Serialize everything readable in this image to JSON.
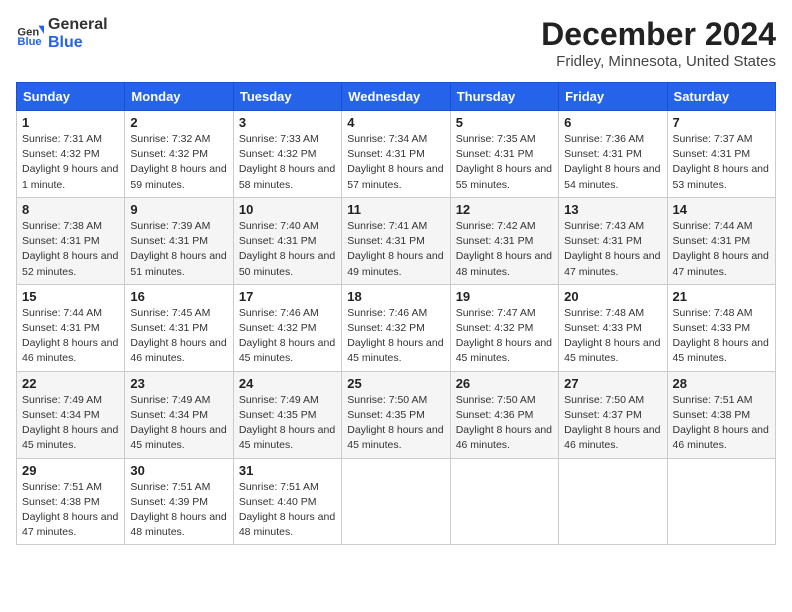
{
  "header": {
    "logo_line1": "General",
    "logo_line2": "Blue",
    "month_title": "December 2024",
    "location": "Fridley, Minnesota, United States"
  },
  "weekdays": [
    "Sunday",
    "Monday",
    "Tuesday",
    "Wednesday",
    "Thursday",
    "Friday",
    "Saturday"
  ],
  "weeks": [
    [
      {
        "day": "1",
        "sunrise": "7:31 AM",
        "sunset": "4:32 PM",
        "daylight": "9 hours and 1 minute."
      },
      {
        "day": "2",
        "sunrise": "7:32 AM",
        "sunset": "4:32 PM",
        "daylight": "8 hours and 59 minutes."
      },
      {
        "day": "3",
        "sunrise": "7:33 AM",
        "sunset": "4:32 PM",
        "daylight": "8 hours and 58 minutes."
      },
      {
        "day": "4",
        "sunrise": "7:34 AM",
        "sunset": "4:31 PM",
        "daylight": "8 hours and 57 minutes."
      },
      {
        "day": "5",
        "sunrise": "7:35 AM",
        "sunset": "4:31 PM",
        "daylight": "8 hours and 55 minutes."
      },
      {
        "day": "6",
        "sunrise": "7:36 AM",
        "sunset": "4:31 PM",
        "daylight": "8 hours and 54 minutes."
      },
      {
        "day": "7",
        "sunrise": "7:37 AM",
        "sunset": "4:31 PM",
        "daylight": "8 hours and 53 minutes."
      }
    ],
    [
      {
        "day": "8",
        "sunrise": "7:38 AM",
        "sunset": "4:31 PM",
        "daylight": "8 hours and 52 minutes."
      },
      {
        "day": "9",
        "sunrise": "7:39 AM",
        "sunset": "4:31 PM",
        "daylight": "8 hours and 51 minutes."
      },
      {
        "day": "10",
        "sunrise": "7:40 AM",
        "sunset": "4:31 PM",
        "daylight": "8 hours and 50 minutes."
      },
      {
        "day": "11",
        "sunrise": "7:41 AM",
        "sunset": "4:31 PM",
        "daylight": "8 hours and 49 minutes."
      },
      {
        "day": "12",
        "sunrise": "7:42 AM",
        "sunset": "4:31 PM",
        "daylight": "8 hours and 48 minutes."
      },
      {
        "day": "13",
        "sunrise": "7:43 AM",
        "sunset": "4:31 PM",
        "daylight": "8 hours and 47 minutes."
      },
      {
        "day": "14",
        "sunrise": "7:44 AM",
        "sunset": "4:31 PM",
        "daylight": "8 hours and 47 minutes."
      }
    ],
    [
      {
        "day": "15",
        "sunrise": "7:44 AM",
        "sunset": "4:31 PM",
        "daylight": "8 hours and 46 minutes."
      },
      {
        "day": "16",
        "sunrise": "7:45 AM",
        "sunset": "4:31 PM",
        "daylight": "8 hours and 46 minutes."
      },
      {
        "day": "17",
        "sunrise": "7:46 AM",
        "sunset": "4:32 PM",
        "daylight": "8 hours and 45 minutes."
      },
      {
        "day": "18",
        "sunrise": "7:46 AM",
        "sunset": "4:32 PM",
        "daylight": "8 hours and 45 minutes."
      },
      {
        "day": "19",
        "sunrise": "7:47 AM",
        "sunset": "4:32 PM",
        "daylight": "8 hours and 45 minutes."
      },
      {
        "day": "20",
        "sunrise": "7:48 AM",
        "sunset": "4:33 PM",
        "daylight": "8 hours and 45 minutes."
      },
      {
        "day": "21",
        "sunrise": "7:48 AM",
        "sunset": "4:33 PM",
        "daylight": "8 hours and 45 minutes."
      }
    ],
    [
      {
        "day": "22",
        "sunrise": "7:49 AM",
        "sunset": "4:34 PM",
        "daylight": "8 hours and 45 minutes."
      },
      {
        "day": "23",
        "sunrise": "7:49 AM",
        "sunset": "4:34 PM",
        "daylight": "8 hours and 45 minutes."
      },
      {
        "day": "24",
        "sunrise": "7:49 AM",
        "sunset": "4:35 PM",
        "daylight": "8 hours and 45 minutes."
      },
      {
        "day": "25",
        "sunrise": "7:50 AM",
        "sunset": "4:35 PM",
        "daylight": "8 hours and 45 minutes."
      },
      {
        "day": "26",
        "sunrise": "7:50 AM",
        "sunset": "4:36 PM",
        "daylight": "8 hours and 46 minutes."
      },
      {
        "day": "27",
        "sunrise": "7:50 AM",
        "sunset": "4:37 PM",
        "daylight": "8 hours and 46 minutes."
      },
      {
        "day": "28",
        "sunrise": "7:51 AM",
        "sunset": "4:38 PM",
        "daylight": "8 hours and 46 minutes."
      }
    ],
    [
      {
        "day": "29",
        "sunrise": "7:51 AM",
        "sunset": "4:38 PM",
        "daylight": "8 hours and 47 minutes."
      },
      {
        "day": "30",
        "sunrise": "7:51 AM",
        "sunset": "4:39 PM",
        "daylight": "8 hours and 48 minutes."
      },
      {
        "day": "31",
        "sunrise": "7:51 AM",
        "sunset": "4:40 PM",
        "daylight": "8 hours and 48 minutes."
      },
      null,
      null,
      null,
      null
    ]
  ]
}
